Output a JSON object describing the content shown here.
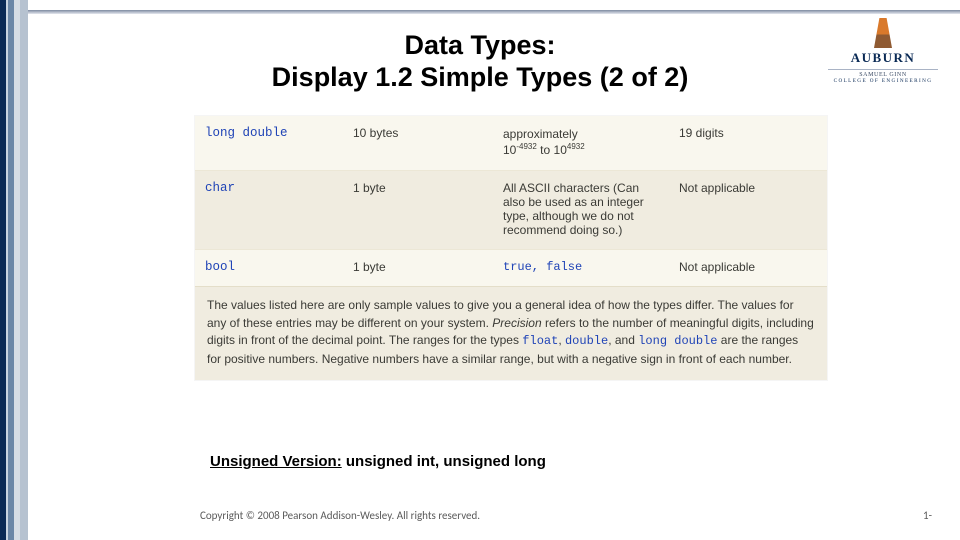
{
  "title": {
    "line1": "Data Types:",
    "line2": "Display 1.2  Simple Types (2 of 2)"
  },
  "logo": {
    "word": "AUBURN",
    "sub1": "SAMUEL GINN",
    "sub2": "COLLEGE OF ENGINEERING"
  },
  "rows": [
    {
      "type": "long double",
      "size": "10 bytes",
      "range_prefix": "approximately",
      "range_low_base": "10",
      "range_low_exp": "-4932",
      "range_join": " to ",
      "range_high_base": "10",
      "range_high_exp": "4932",
      "precision": "19 digits"
    },
    {
      "type": "char",
      "size": "1 byte",
      "range_text": "All ASCII characters (Can also be used as an integer type, although we do not recommend doing so.)",
      "precision": "Not applicable"
    },
    {
      "type": "bool",
      "size": "1 byte",
      "range_code": "true, false",
      "precision": "Not applicable"
    }
  ],
  "note": {
    "pre1": "The values listed here are only sample values to give you a general idea of how the types differ. The values for any of these entries may be different on your system. ",
    "precision_label": "Precision",
    "pre2": " refers to the number of meaningful digits, including digits in front of the decimal point. The ranges for the types ",
    "t1": "float",
    "s1": ", ",
    "t2": "double",
    "s2": ", and ",
    "t3": "long double",
    "post": " are the ranges for positive numbers. Negative numbers have a similar range, but with a negative sign in front of each number."
  },
  "unsigned": {
    "label": "Unsigned Version:",
    "text": " unsigned int, unsigned long"
  },
  "footer": {
    "copyright": "Copyright © 2008 Pearson Addison-Wesley. All rights reserved.",
    "page": "1-"
  }
}
